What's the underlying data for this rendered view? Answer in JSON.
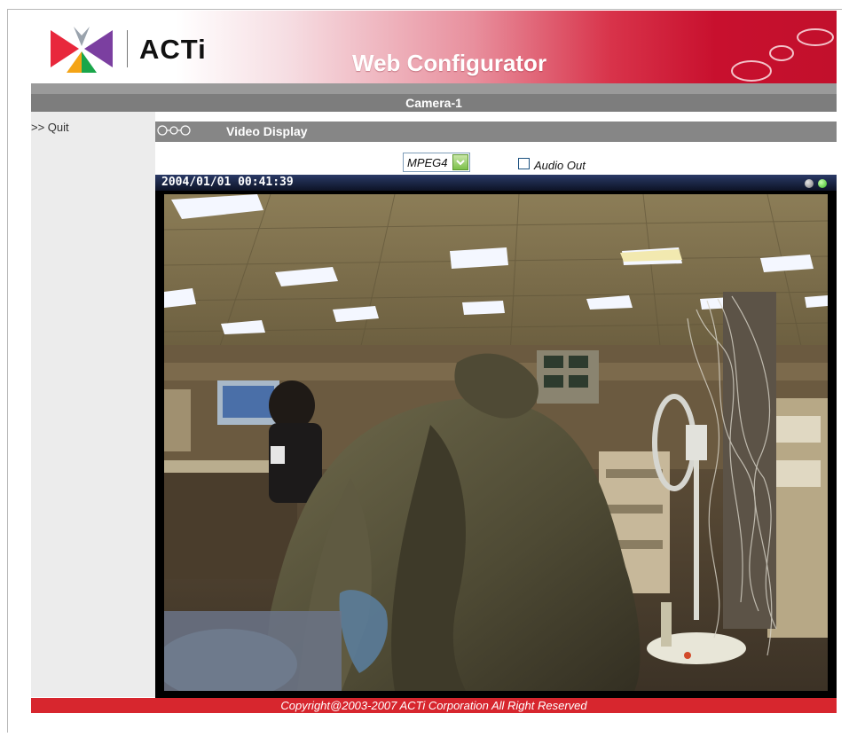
{
  "brand": {
    "logo_text": "ACTi",
    "app_title": "Web Configurator"
  },
  "camera": {
    "name": "Camera-1"
  },
  "sidebar": {
    "quit_label": ">> Quit"
  },
  "section": {
    "title": "Video Display"
  },
  "controls": {
    "codec_selected": "MPEG4",
    "audio_out_label": "Audio Out",
    "audio_out_checked": false
  },
  "player": {
    "timestamp": "2004/01/01 00:41:39",
    "status_dots": [
      "gray",
      "green"
    ]
  },
  "footer": {
    "copyright": "Copyright@2003-2007 ACTi Corporation All Right Reserved"
  },
  "colors": {
    "brand_red": "#c8102e",
    "bar_gray": "#868686",
    "footer_red": "#d7262e",
    "status_green": "#44cc33"
  }
}
